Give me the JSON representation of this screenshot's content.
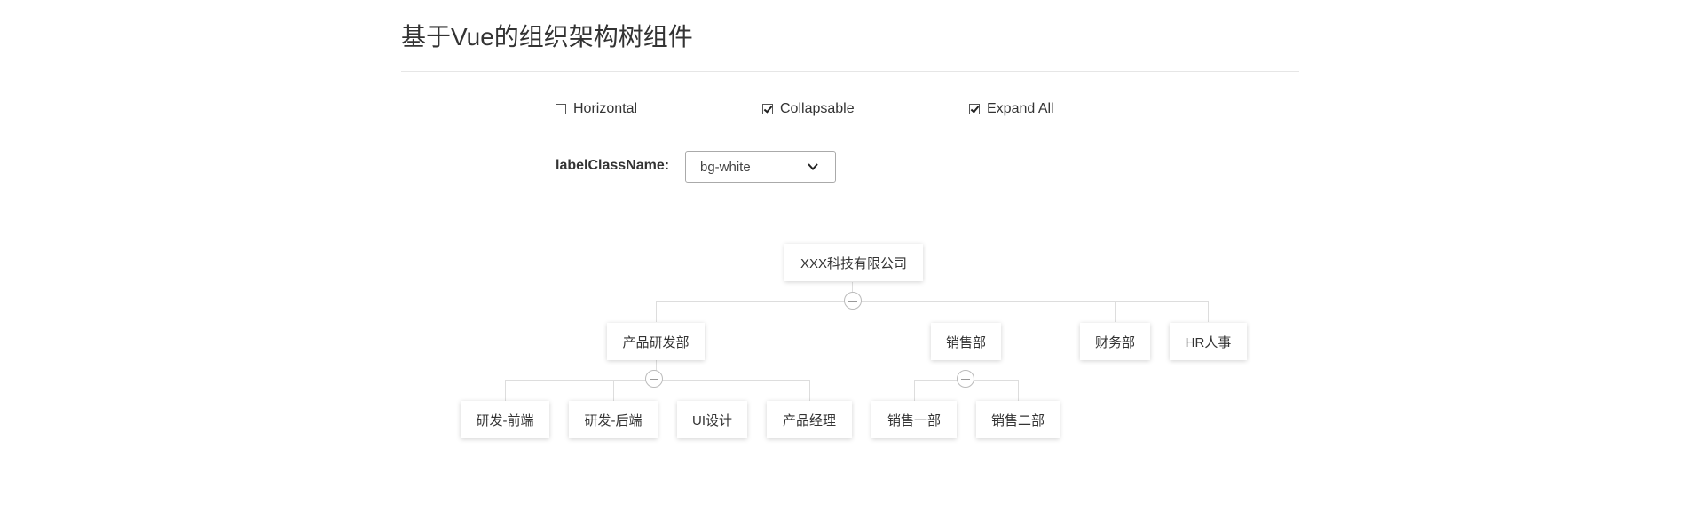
{
  "page": {
    "title": "基于Vue的组织架构树组件"
  },
  "options": {
    "horizontal": {
      "label": "Horizontal",
      "checked": false
    },
    "collapsable": {
      "label": "Collapsable",
      "checked": true
    },
    "expand_all": {
      "label": "Expand All",
      "checked": true
    }
  },
  "label_class": {
    "label": "labelClassName:",
    "value": "bg-white"
  },
  "tree": {
    "root": "XXX科技有限公司",
    "departments": [
      {
        "label": "产品研发部",
        "children": [
          "研发-前端",
          "研发-后端",
          "UI设计",
          "产品经理"
        ]
      },
      {
        "label": "销售部",
        "children": [
          "销售一部",
          "销售二部"
        ]
      },
      {
        "label": "财务部"
      },
      {
        "label": "HR人事"
      }
    ]
  }
}
